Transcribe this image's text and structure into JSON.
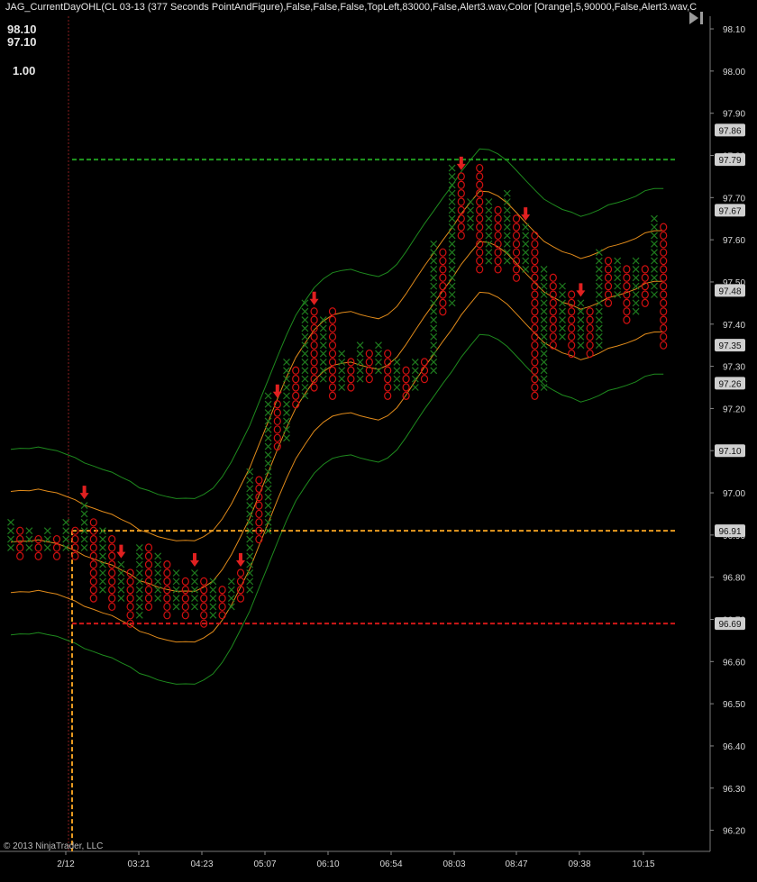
{
  "header": {
    "indicator_label": "JAG_CurrentDayOHL(CL 03-13 (377 Seconds PointAndFigure),False,False,False,TopLeft,83000,False,Alert3.wav,Color [Orange],5,90000,False,Alert3.wav,C",
    "high_value": "98.10",
    "low_value": "97.10",
    "ratio_value": "1.00",
    "play_icon": "skip-forward-icon"
  },
  "footer": {
    "copyright": "© 2013 NinjaTrader, LLC"
  },
  "colors": {
    "background": "#000000",
    "x_box": "#1e7a1e",
    "o_box": "#d01010",
    "orange_band": "#e08a1a",
    "green_band": "#1e8a1e",
    "dashed_green": "#1f9a1f",
    "dashed_red": "#d01818",
    "dashed_orange": "#e89a20",
    "arrow": "#e02020"
  },
  "chart_data": {
    "type": "point-and-figure",
    "y_axis": {
      "min": 96.15,
      "max": 98.13,
      "ticks": [
        "98.10",
        "98.00",
        "97.90",
        "97.80",
        "97.70",
        "97.60",
        "97.50",
        "97.40",
        "97.30",
        "97.20",
        "97.10",
        "97.00",
        "96.90",
        "96.80",
        "96.70",
        "96.60",
        "96.50",
        "96.40",
        "96.30",
        "96.20"
      ]
    },
    "x_axis": {
      "ticks": [
        "2/12",
        "03:21",
        "04:23",
        "05:07",
        "06:10",
        "06:54",
        "08:03",
        "08:47",
        "09:38",
        "10:15"
      ]
    },
    "price_labels": [
      "97.86",
      "97.79",
      "97.67",
      "97.48",
      "97.35",
      "97.26",
      "97.10",
      "96.91",
      "96.69"
    ],
    "box_size": 0.02,
    "columns": [
      {
        "type": "X",
        "low": 96.87,
        "high": 96.93
      },
      {
        "type": "O",
        "low": 96.85,
        "high": 96.91
      },
      {
        "type": "X",
        "low": 96.87,
        "high": 96.91
      },
      {
        "type": "O",
        "low": 96.85,
        "high": 96.89
      },
      {
        "type": "X",
        "low": 96.87,
        "high": 96.91
      },
      {
        "type": "O",
        "low": 96.85,
        "high": 96.89
      },
      {
        "type": "X",
        "low": 96.87,
        "high": 96.93
      },
      {
        "type": "O",
        "low": 96.85,
        "high": 96.91
      },
      {
        "type": "X",
        "low": 96.87,
        "high": 96.97
      },
      {
        "type": "O",
        "low": 96.75,
        "high": 96.93
      },
      {
        "type": "X",
        "low": 96.77,
        "high": 96.91
      },
      {
        "type": "O",
        "low": 96.73,
        "high": 96.89
      },
      {
        "type": "X",
        "low": 96.75,
        "high": 96.83
      },
      {
        "type": "O",
        "low": 96.69,
        "high": 96.81
      },
      {
        "type": "X",
        "low": 96.71,
        "high": 96.87
      },
      {
        "type": "O",
        "low": 96.73,
        "high": 96.87
      },
      {
        "type": "X",
        "low": 96.75,
        "high": 96.85
      },
      {
        "type": "O",
        "low": 96.71,
        "high": 96.83
      },
      {
        "type": "X",
        "low": 96.73,
        "high": 96.81
      },
      {
        "type": "O",
        "low": 96.71,
        "high": 96.79
      },
      {
        "type": "X",
        "low": 96.73,
        "high": 96.81
      },
      {
        "type": "O",
        "low": 96.69,
        "high": 96.79
      },
      {
        "type": "X",
        "low": 96.71,
        "high": 96.79
      },
      {
        "type": "O",
        "low": 96.71,
        "high": 96.77
      },
      {
        "type": "X",
        "low": 96.73,
        "high": 96.79
      },
      {
        "type": "O",
        "low": 96.75,
        "high": 96.81
      },
      {
        "type": "X",
        "low": 96.77,
        "high": 97.05
      },
      {
        "type": "O",
        "low": 96.89,
        "high": 97.03
      },
      {
        "type": "X",
        "low": 96.91,
        "high": 97.23
      },
      {
        "type": "O",
        "low": 97.11,
        "high": 97.21
      },
      {
        "type": "X",
        "low": 97.13,
        "high": 97.31
      },
      {
        "type": "O",
        "low": 97.21,
        "high": 97.29
      },
      {
        "type": "X",
        "low": 97.23,
        "high": 97.45
      },
      {
        "type": "O",
        "low": 97.25,
        "high": 97.43
      },
      {
        "type": "X",
        "low": 97.27,
        "high": 97.41
      },
      {
        "type": "O",
        "low": 97.23,
        "high": 97.43
      },
      {
        "type": "X",
        "low": 97.25,
        "high": 97.33
      },
      {
        "type": "O",
        "low": 97.25,
        "high": 97.31
      },
      {
        "type": "X",
        "low": 97.27,
        "high": 97.35
      },
      {
        "type": "O",
        "low": 97.27,
        "high": 97.33
      },
      {
        "type": "X",
        "low": 97.29,
        "high": 97.35
      },
      {
        "type": "O",
        "low": 97.23,
        "high": 97.33
      },
      {
        "type": "X",
        "low": 97.25,
        "high": 97.31
      },
      {
        "type": "O",
        "low": 97.23,
        "high": 97.29
      },
      {
        "type": "X",
        "low": 97.25,
        "high": 97.31
      },
      {
        "type": "O",
        "low": 97.27,
        "high": 97.31
      },
      {
        "type": "X",
        "low": 97.29,
        "high": 97.59
      },
      {
        "type": "O",
        "low": 97.43,
        "high": 97.57
      },
      {
        "type": "X",
        "low": 97.45,
        "high": 97.77
      },
      {
        "type": "O",
        "low": 97.61,
        "high": 97.75
      },
      {
        "type": "X",
        "low": 97.63,
        "high": 97.69
      },
      {
        "type": "O",
        "low": 97.53,
        "high": 97.77
      },
      {
        "type": "X",
        "low": 97.55,
        "high": 97.69
      },
      {
        "type": "O",
        "low": 97.53,
        "high": 97.67
      },
      {
        "type": "X",
        "low": 97.55,
        "high": 97.71
      },
      {
        "type": "O",
        "low": 97.51,
        "high": 97.65
      },
      {
        "type": "X",
        "low": 97.53,
        "high": 97.63
      },
      {
        "type": "O",
        "low": 97.23,
        "high": 97.61
      },
      {
        "type": "X",
        "low": 97.25,
        "high": 97.53
      },
      {
        "type": "O",
        "low": 97.35,
        "high": 97.51
      },
      {
        "type": "X",
        "low": 97.37,
        "high": 97.49
      },
      {
        "type": "O",
        "low": 97.33,
        "high": 97.47
      },
      {
        "type": "X",
        "low": 97.35,
        "high": 97.45
      },
      {
        "type": "O",
        "low": 97.33,
        "high": 97.43
      },
      {
        "type": "X",
        "low": 97.35,
        "high": 97.57
      },
      {
        "type": "O",
        "low": 97.45,
        "high": 97.55
      },
      {
        "type": "X",
        "low": 97.47,
        "high": 97.55
      },
      {
        "type": "O",
        "low": 97.41,
        "high": 97.53
      },
      {
        "type": "X",
        "low": 97.43,
        "high": 97.55
      },
      {
        "type": "O",
        "low": 97.45,
        "high": 97.53
      },
      {
        "type": "X",
        "low": 97.47,
        "high": 97.65
      },
      {
        "type": "O",
        "low": 97.35,
        "high": 97.63
      }
    ],
    "levels": [
      {
        "name": "high",
        "value": 97.79,
        "color": "#1f9a1f"
      },
      {
        "name": "open",
        "value": 96.91,
        "color": "#e89a20"
      },
      {
        "name": "low",
        "value": 96.69,
        "color": "#d01818"
      }
    ],
    "arrows": [
      8,
      12,
      20,
      25,
      29,
      33,
      49,
      56,
      62,
      73
    ]
  }
}
